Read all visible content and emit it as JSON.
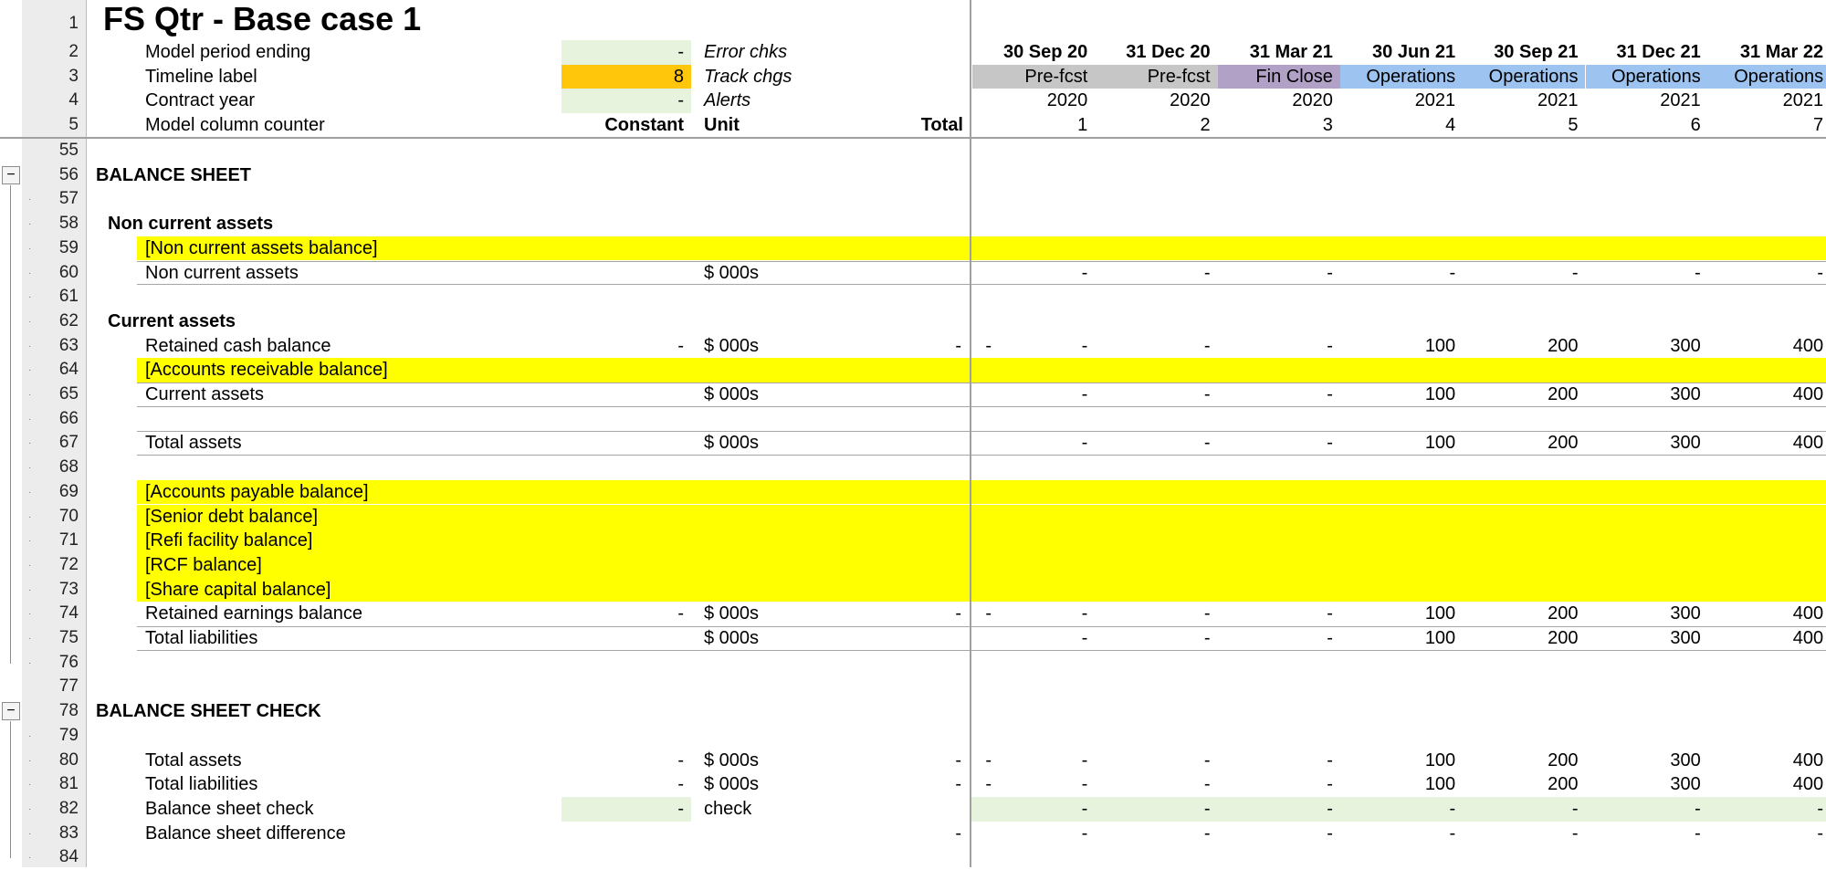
{
  "sheet": {
    "title": "FS Qtr - Base case 1",
    "header_rows": [
      {
        "num": "2",
        "label": "Model period ending",
        "constant": "-",
        "unit": "Error chks"
      },
      {
        "num": "3",
        "label": "Timeline label",
        "constant": "8",
        "unit": "Track chgs"
      },
      {
        "num": "4",
        "label": "Contract year",
        "constant": "-",
        "unit": "Alerts"
      },
      {
        "num": "5",
        "label": "Model column counter",
        "constant": "Constant",
        "unit": "Unit",
        "total": "Total"
      }
    ],
    "periods": {
      "dates": [
        "30 Sep 20",
        "31 Dec 20",
        "31 Mar 21",
        "30 Jun 21",
        "30 Sep 21",
        "31 Dec 21",
        "31 Mar 22"
      ],
      "labels": [
        "Pre-fcst",
        "Pre-fcst",
        "Fin Close",
        "Operations",
        "Operations",
        "Operations",
        "Operations"
      ],
      "years": [
        "2020",
        "2020",
        "2020",
        "2021",
        "2021",
        "2021",
        "2021"
      ],
      "counters": [
        "1",
        "2",
        "3",
        "4",
        "5",
        "6",
        "7"
      ]
    },
    "colors": {
      "highlight": "#ffff00",
      "input_green": "#e8f3de",
      "timeline_orange": "#ffc60b",
      "pre_fcst": "#c6c6c6",
      "fin_close": "#b2a1c7",
      "operations": "#9dc3f0"
    },
    "rows": [
      {
        "num": "55"
      },
      {
        "num": "56",
        "section": "BALANCE SHEET"
      },
      {
        "num": "57"
      },
      {
        "num": "58",
        "subsection": "Non current assets"
      },
      {
        "num": "59",
        "placeholder": "[Non current assets balance]"
      },
      {
        "num": "60",
        "label": "Non current assets",
        "unit": "$ 000s",
        "values": [
          "-",
          "-",
          "-",
          "-",
          "-",
          "-",
          "-"
        ]
      },
      {
        "num": "61"
      },
      {
        "num": "62",
        "subsection": "Current assets"
      },
      {
        "num": "63",
        "label": "Retained cash balance",
        "constant": "-",
        "unit": "$ 000s",
        "total": "-",
        "total2": "-",
        "values": [
          "-",
          "-",
          "-",
          "100",
          "200",
          "300",
          "400"
        ]
      },
      {
        "num": "64",
        "placeholder": "[Accounts receivable balance]"
      },
      {
        "num": "65",
        "label": "Current assets",
        "unit": "$ 000s",
        "values": [
          "-",
          "-",
          "-",
          "100",
          "200",
          "300",
          "400"
        ]
      },
      {
        "num": "66"
      },
      {
        "num": "67",
        "label": "Total assets",
        "unit": "$ 000s",
        "values": [
          "-",
          "-",
          "-",
          "100",
          "200",
          "300",
          "400"
        ]
      },
      {
        "num": "68"
      },
      {
        "num": "69",
        "placeholder": "[Accounts payable balance]"
      },
      {
        "num": "70",
        "placeholder": "[Senior debt balance]"
      },
      {
        "num": "71",
        "placeholder": "[Refi facility balance]"
      },
      {
        "num": "72",
        "placeholder": "[RCF balance]"
      },
      {
        "num": "73",
        "placeholder": "[Share capital balance]"
      },
      {
        "num": "74",
        "label": "Retained earnings balance",
        "constant": "-",
        "unit": "$ 000s",
        "total": "-",
        "total2": "-",
        "values": [
          "-",
          "-",
          "-",
          "100",
          "200",
          "300",
          "400"
        ]
      },
      {
        "num": "75",
        "label": "Total liabilities",
        "unit": "$ 000s",
        "values": [
          "-",
          "-",
          "-",
          "100",
          "200",
          "300",
          "400"
        ]
      },
      {
        "num": "76"
      },
      {
        "num": "77"
      },
      {
        "num": "78",
        "section": "BALANCE SHEET CHECK"
      },
      {
        "num": "79"
      },
      {
        "num": "80",
        "label": "Total assets",
        "constant": "-",
        "unit": "$ 000s",
        "total": "-",
        "total2": "-",
        "values": [
          "-",
          "-",
          "-",
          "100",
          "200",
          "300",
          "400"
        ]
      },
      {
        "num": "81",
        "label": "Total liabilities",
        "constant": "-",
        "unit": "$ 000s",
        "total": "-",
        "total2": "-",
        "values": [
          "-",
          "-",
          "-",
          "100",
          "200",
          "300",
          "400"
        ]
      },
      {
        "num": "82",
        "label": "Balance sheet check",
        "constant": "-",
        "unit": "check",
        "values": [
          "-",
          "-",
          "-",
          "-",
          "-",
          "-",
          "-"
        ]
      },
      {
        "num": "83",
        "label": "Balance sheet difference",
        "total": "-",
        "values": [
          "-",
          "-",
          "-",
          "-",
          "-",
          "-",
          "-"
        ]
      },
      {
        "num": "84"
      }
    ]
  }
}
